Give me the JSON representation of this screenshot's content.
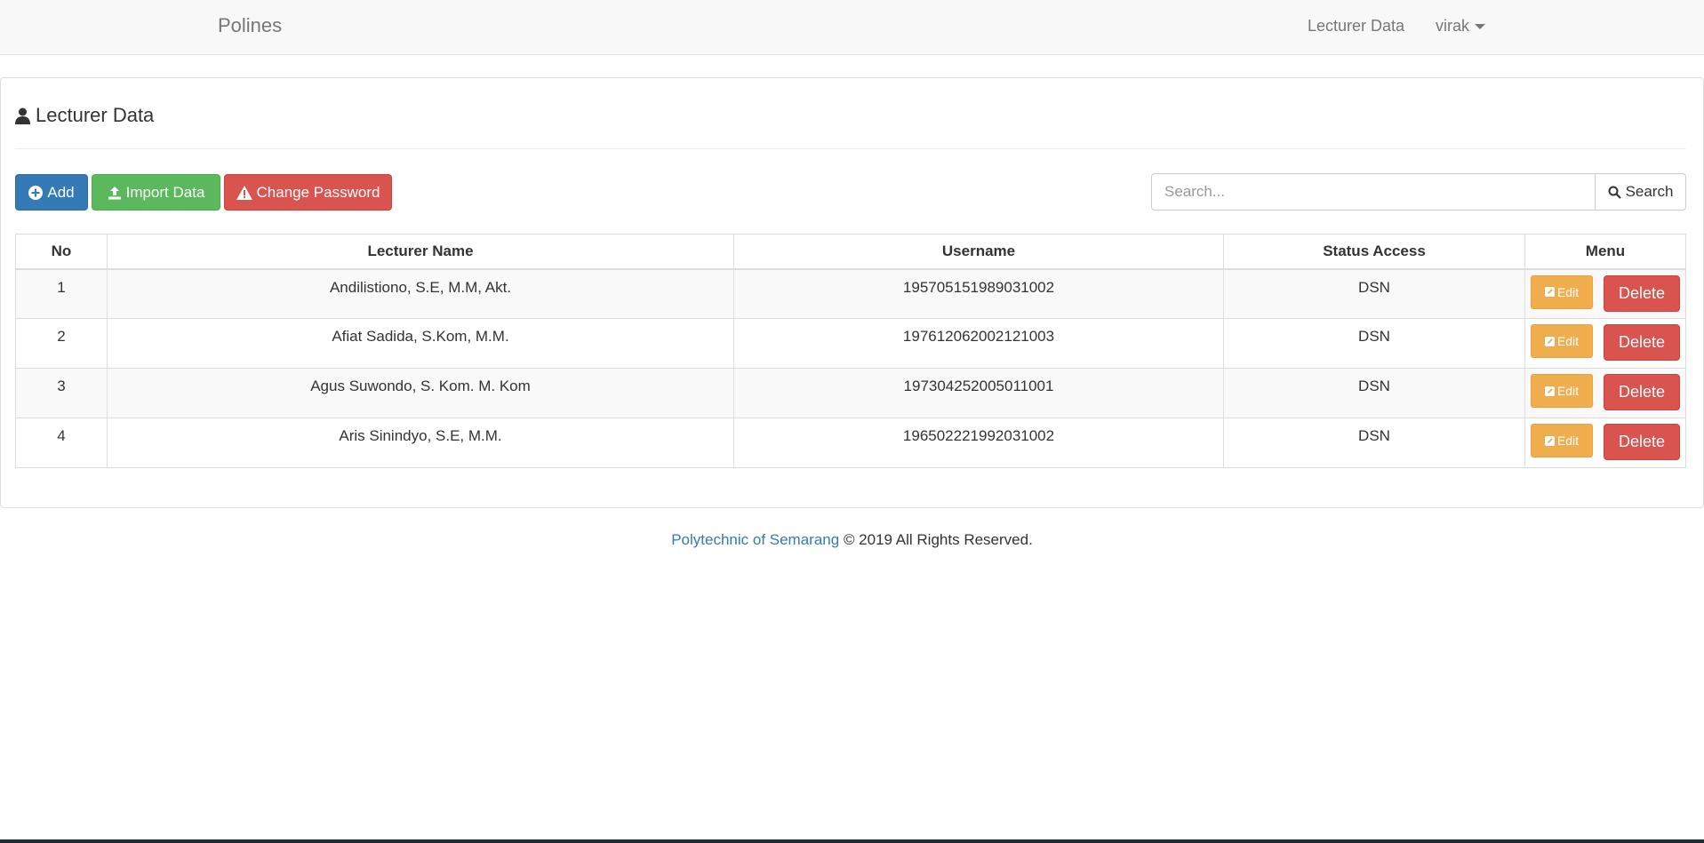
{
  "navbar": {
    "brand": "Polines",
    "links": [
      {
        "label": "Lecturer Data"
      },
      {
        "label": "virak"
      }
    ]
  },
  "panel": {
    "title": "Lecturer Data",
    "buttons": {
      "add": "Add",
      "import": "Import Data",
      "change_password": "Change Password"
    },
    "search": {
      "placeholder": "Search...",
      "value": "",
      "button": "Search"
    }
  },
  "table": {
    "headers": [
      "No",
      "Lecturer Name",
      "Username",
      "Status Access",
      "Menu"
    ],
    "rows": [
      {
        "no": "1",
        "name": "Andilistiono, S.E, M.M, Akt.",
        "username": "195705151989031002",
        "status": "DSN"
      },
      {
        "no": "2",
        "name": "Afiat Sadida, S.Kom, M.M.",
        "username": "197612062002121003",
        "status": "DSN"
      },
      {
        "no": "3",
        "name": "Agus Suwondo, S. Kom. M. Kom",
        "username": "197304252005011001",
        "status": "DSN"
      },
      {
        "no": "4",
        "name": "Aris Sinindyo, S.E, M.M.",
        "username": "196502221992031002",
        "status": "DSN"
      }
    ],
    "edit_label": "Edit",
    "delete_label": "Delete"
  },
  "footer": {
    "link": "Polytechnic of Semarang",
    "text": "© 2019 All Rights Reserved."
  },
  "colors": {
    "primary": "#337ab7",
    "success": "#5cb85c",
    "danger": "#d9534f",
    "warning": "#f0ad4e"
  },
  "icons": {
    "title": "user-icon",
    "add": "plus-circle-icon",
    "import": "upload-icon",
    "change_password": "warning-icon",
    "search": "search-icon",
    "edit": "edit-icon"
  }
}
